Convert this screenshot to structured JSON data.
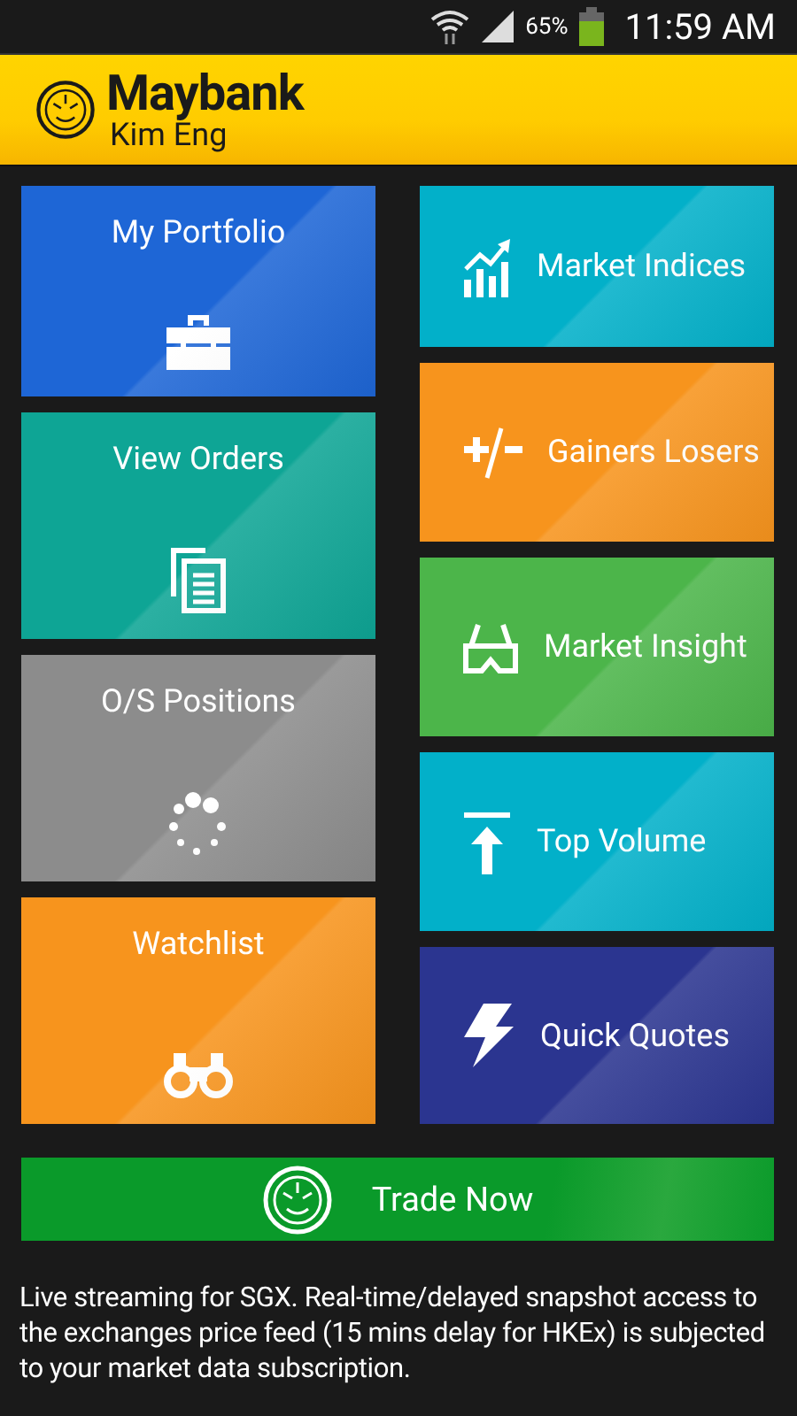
{
  "status_bar": {
    "battery_percent": "65%",
    "time": "11:59 AM"
  },
  "header": {
    "brand": "Maybank",
    "sub_brand": "Kim Eng"
  },
  "tiles_left": [
    {
      "label": "My Portfolio",
      "color": "#1e66d6"
    },
    {
      "label": "View Orders",
      "color": "#0ea595"
    },
    {
      "label": "O/S Positions",
      "color": "#8c8c8c"
    },
    {
      "label": "Watchlist",
      "color": "#f7941d"
    }
  ],
  "tiles_right": [
    {
      "label": "Market Indices",
      "color": "#02b0c9"
    },
    {
      "label": "Gainers Losers",
      "color": "#f7941d"
    },
    {
      "label": "Market Insight",
      "color": "#4cb54a"
    },
    {
      "label": "Top Volume",
      "color": "#02b0c9"
    },
    {
      "label": "Quick Quotes",
      "color": "#2b3590"
    }
  ],
  "trade_button": {
    "label": "Trade Now"
  },
  "disclaimer": "Live streaming for SGX. Real-time/delayed snapshot access to the exchanges price feed (15 mins delay for HKEx) is subjected to your market data subscription."
}
